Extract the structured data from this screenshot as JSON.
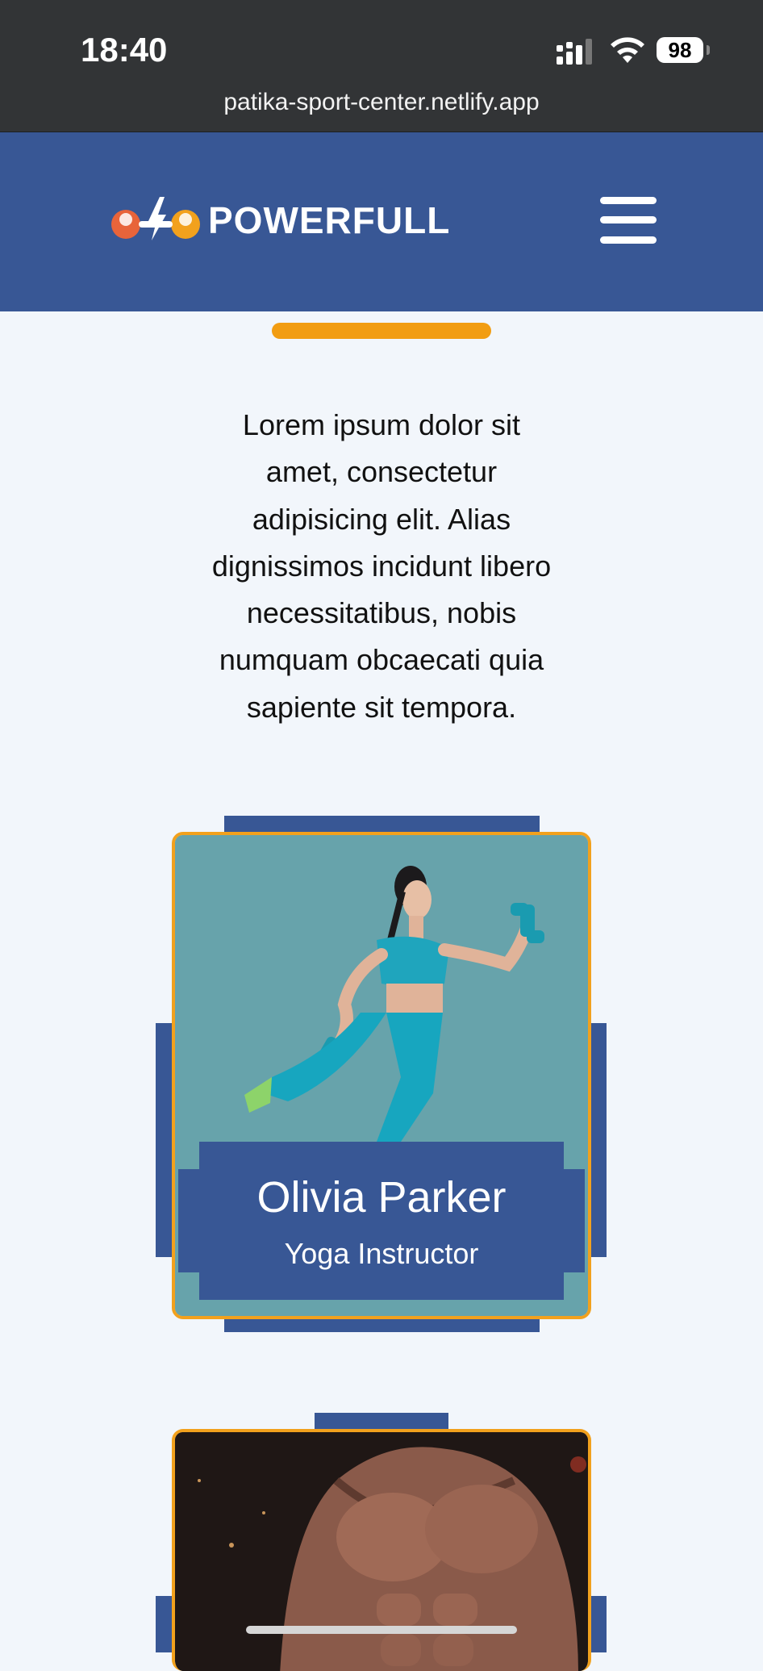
{
  "status_bar": {
    "time": "18:40",
    "battery": "98",
    "url": "patika-sport-center.netlify.app"
  },
  "header": {
    "logo_text": "POWERFULL",
    "menu_icon": "hamburger-icon"
  },
  "intro": {
    "text": "Lorem ipsum dolor sit amet, consectetur adipisicing elit. Alias dignissimos incidunt libero necessitatibus, nobis numquam obcaecati quia sapiente sit tempora."
  },
  "trainers": [
    {
      "name": "Olivia Parker",
      "role": "Yoga Instructor"
    }
  ],
  "colors": {
    "brand_blue": "#385795",
    "accent_orange": "#f29d12",
    "page_bg": "#f2f6fb",
    "status_bar": "#323436"
  }
}
